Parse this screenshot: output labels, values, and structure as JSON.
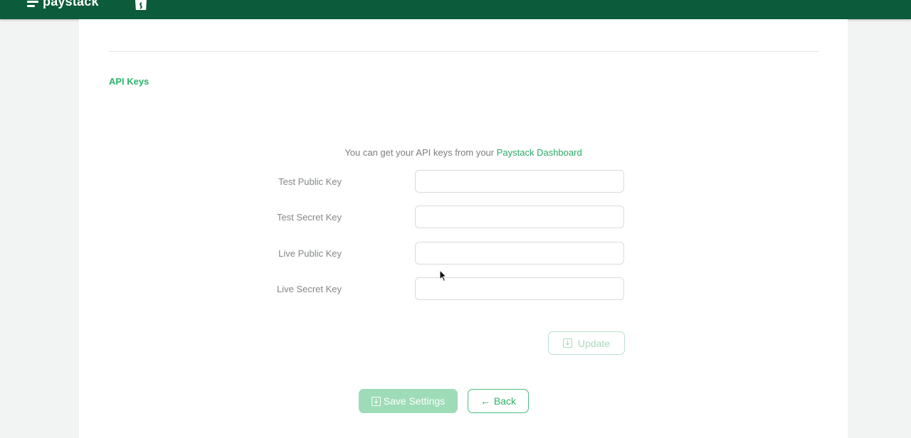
{
  "header": {
    "brand": "paystack",
    "shop_icon": "shopify-bag-icon",
    "background_color": "#0c5c3b"
  },
  "settings": {
    "section_title": "API Keys",
    "info_text": "You can get your API keys from your ",
    "info_link": "Paystack Dashboard",
    "fields": [
      {
        "label": "Test Public Key",
        "value": ""
      },
      {
        "label": "Test Secret Key",
        "value": ""
      },
      {
        "label": "Live Public Key",
        "value": ""
      },
      {
        "label": "Live Secret Key",
        "value": ""
      }
    ],
    "update_label": "Update",
    "save_label": "Save Settings",
    "back_label": "Back"
  },
  "colors": {
    "accent": "#2bb36a",
    "save_button_bg": "#9ddcb7"
  }
}
